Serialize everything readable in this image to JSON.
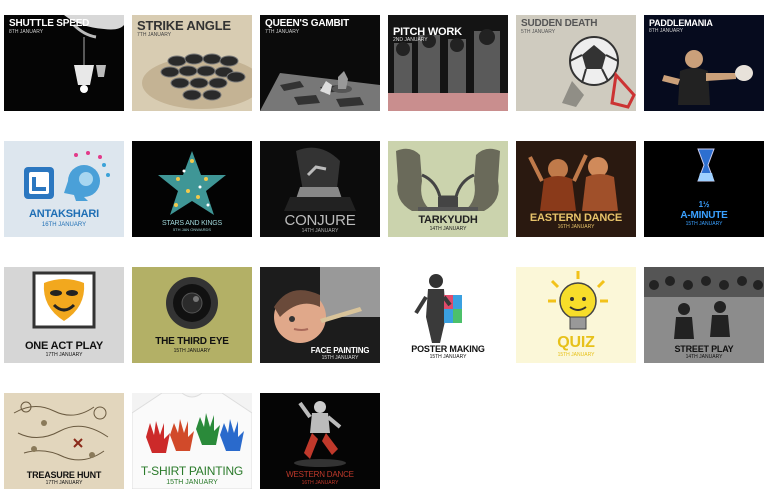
{
  "events": [
    {
      "title": "SHUTTLE SPEED",
      "date": "8TH JANUARY",
      "icon": "shuttlecock-icon"
    },
    {
      "title": "STRIKE ANGLE",
      "date": "7TH JANUARY",
      "icon": "carrom-icon"
    },
    {
      "title": "QUEEN'S GAMBIT",
      "date": "7TH JANUARY",
      "icon": "chess-icon"
    },
    {
      "title": "PITCH WORK",
      "date": "2ND JANUARY",
      "icon": "cricket-icon"
    },
    {
      "title": "SUDDEN DEATH",
      "date": "5TH JANUARY",
      "icon": "football-icon"
    },
    {
      "title": "PADDLEMANIA",
      "date": "8TH JANUARY",
      "icon": "table-tennis-icon"
    },
    {
      "title": "ANTAKSHARI",
      "date": "16TH JANUARY",
      "icon": "music-head-icon"
    },
    {
      "title": "STARS AND KINGS",
      "date": "5TH JAN ONWARDS",
      "icon": "star-icon"
    },
    {
      "title": "CONJURE",
      "date": "14TH JANUARY",
      "icon": "magic-hands-icon"
    },
    {
      "title": "TARKYUDH",
      "date": "14TH JANUARY",
      "icon": "debate-icon"
    },
    {
      "title": "EASTERN DANCE",
      "date": "16TH JANUARY",
      "icon": "dancer-icon"
    },
    {
      "title": "A-MINUTE",
      "prefix": "1½",
      "date": "15TH JANUARY",
      "icon": "hourglass-icon"
    },
    {
      "title": "ONE ACT PLAY",
      "date": "17TH JANUARY",
      "icon": "theatre-mask-icon"
    },
    {
      "title": "THE THIRD EYE",
      "date": "15TH JANUARY",
      "icon": "camera-lens-icon"
    },
    {
      "title": "FACE PAINTING",
      "date": "15TH JANUARY",
      "icon": "face-paint-icon"
    },
    {
      "title": "POSTER MAKING",
      "date": "15TH JANUARY",
      "icon": "poster-icon"
    },
    {
      "title": "QUIZ",
      "date": "15TH JANUARY",
      "icon": "light-bulb-icon"
    },
    {
      "title": "STREET PLAY",
      "date": "14TH JANUARY",
      "icon": "crowd-icon"
    },
    {
      "title": "TREASURE HUNT",
      "date": "17TH JANUARY",
      "icon": "treasure-map-icon"
    },
    {
      "title": "T-SHIRT PAINTING",
      "date": "15TH JANUARY",
      "icon": "painted-hands-icon"
    },
    {
      "title": "WESTERN DANCE",
      "date": "16TH JANUARY",
      "icon": "breakdancer-icon"
    }
  ]
}
